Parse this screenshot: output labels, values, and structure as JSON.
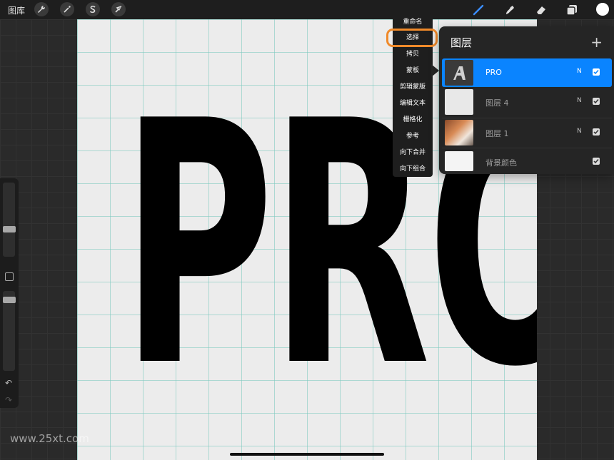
{
  "topbar": {
    "gallery_label": "图库",
    "left_tools": [
      "wrench-icon",
      "magic-wand-icon",
      "selection-s-icon",
      "arrow-cursor-icon"
    ],
    "right_tools": [
      "brush-icon",
      "smudge-icon",
      "eraser-icon",
      "layers-icon",
      "color-circle"
    ],
    "brush_color": "#3a8dff",
    "active_color": "#ffffff"
  },
  "canvas": {
    "text": "PRO",
    "grid_color": "#8cd0c6"
  },
  "context_menu": {
    "items": [
      "重命名",
      "选择",
      "拷贝",
      "蒙板",
      "剪辑蒙版",
      "编辑文本",
      "栅格化",
      "参考",
      "向下合并",
      "向下组合"
    ],
    "highlighted": "选择",
    "highlight_color": "#f08a2a"
  },
  "layers_panel": {
    "title": "图层",
    "add_symbol": "+",
    "layers": [
      {
        "name": "PRO",
        "mode": "N",
        "active": true,
        "checked": true
      },
      {
        "name": "图层 4",
        "mode": "N",
        "active": false,
        "checked": true
      },
      {
        "name": "图层 1",
        "mode": "N",
        "active": false,
        "checked": true
      },
      {
        "name": "背景颜色",
        "mode": "",
        "active": false,
        "checked": true
      }
    ],
    "active_color": "#0a84ff"
  },
  "sidebar": {
    "brush_size_level": 0.5,
    "opacity_level": 0.95
  },
  "watermark": "www.25xt.com"
}
